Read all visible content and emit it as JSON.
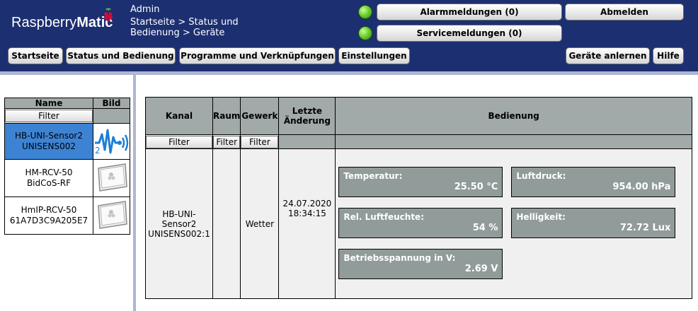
{
  "header": {
    "logo": {
      "part1": "Raspberry",
      "part2": "Matic"
    },
    "user": "Admin",
    "breadcrumb": "Startseite > Status und Bedienung > Geräte",
    "alarm_label": "Alarmmeldungen (0)",
    "service_label": "Servicemeldungen (0)",
    "logout_label": "Abmelden",
    "nav": [
      "Startseite",
      "Status und Bedienung",
      "Programme und Verknüpfungen",
      "Einstellungen"
    ],
    "learn_label": "Geräte anlernen",
    "help_label": "Hilfe",
    "colors": {
      "header_bg": "#1c2f71",
      "led_ok": "#6fd12e"
    }
  },
  "device_list": {
    "col_name": "Name",
    "col_pic": "Bild",
    "filter_label": "Filter",
    "devices": [
      {
        "line1": "HB-UNI-Sensor2",
        "line2": "UNISENS002",
        "pic": "sensor-signal-icon",
        "badge": "2",
        "selected": true
      },
      {
        "line1": "HM-RCV-50",
        "line2": "BidCoS-RF",
        "pic": "raspberry-device-icon",
        "selected": false
      },
      {
        "line1": "HmIP-RCV-50",
        "line2": "61A7D3C9A205E7",
        "pic": "raspberry-device-icon",
        "selected": false
      }
    ],
    "colors": {
      "selected_bg": "#3d83d4"
    }
  },
  "channels": {
    "headers": {
      "kanal": "Kanal",
      "raum": "Raum",
      "gewerk": "Gewerk",
      "aenderung_l1": "Letzte",
      "aenderung_l2": "Änderung",
      "bedienung": "Bedienung"
    },
    "filter_label": "Filter",
    "row": {
      "kanal_l1": "HB-UNI-",
      "kanal_l2": "Sensor2",
      "kanal_l3": "UNISENS002:1",
      "raum": "",
      "gewerk": "Wetter",
      "date": "24.07.2020",
      "time": "18:34:15"
    },
    "datapoints": {
      "temperatur": {
        "label": "Temperatur:",
        "value": "25.50 °C"
      },
      "luftdruck": {
        "label": "Luftdruck:",
        "value": "954.00 hPa"
      },
      "feuchte": {
        "label": "Rel. Luftfeuchte:",
        "value": "54 %"
      },
      "helligkeit": {
        "label": "Helligkeit:",
        "value": "72.72 Lux"
      },
      "spannung": {
        "label": "Betriebsspannung in V:",
        "value": "2.69 V"
      }
    }
  }
}
